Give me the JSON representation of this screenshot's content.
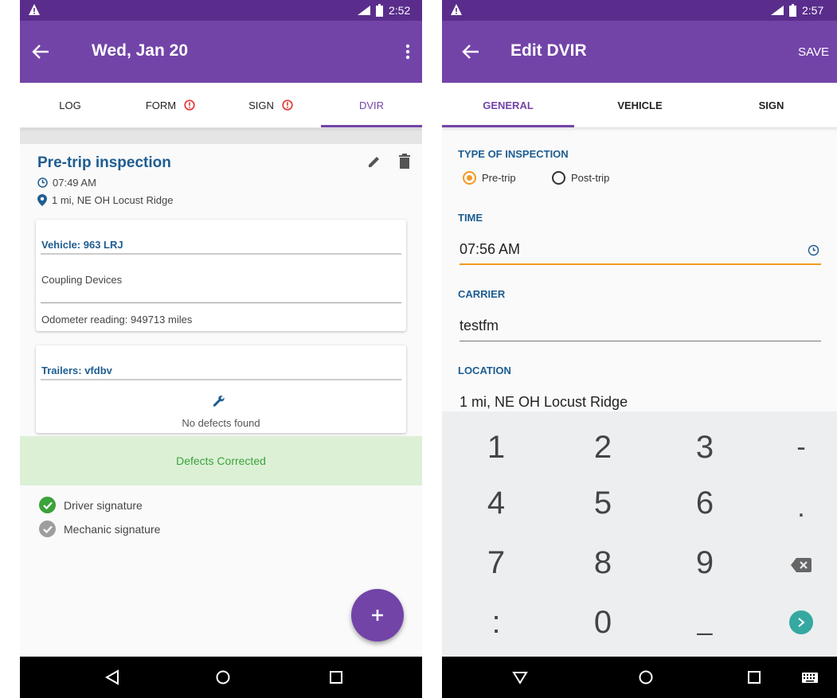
{
  "colors": {
    "primary": "#7244a8",
    "status": "#5a2d8c",
    "accent": "#f39a24",
    "heading_blue": "#1e5d91",
    "alert_red": "#e53935",
    "success_green": "#3ba33a",
    "fab_teal": "#35a8a0"
  },
  "left": {
    "status": {
      "time": "2:52"
    },
    "appbar": {
      "title": "Wed, Jan 20",
      "back_icon": "arrow-back-icon",
      "menu_icon": "more-vert-icon"
    },
    "tabs": [
      {
        "label": "LOG",
        "alert": false,
        "active": false
      },
      {
        "label": "FORM",
        "alert": true,
        "active": false
      },
      {
        "label": "SIGN",
        "alert": true,
        "active": false
      },
      {
        "label": "DVIR",
        "alert": false,
        "active": true
      }
    ],
    "inspection": {
      "title": "Pre-trip inspection",
      "time": "07:49 AM",
      "location": "1 mi, NE OH Locust Ridge"
    },
    "vehicle_card": {
      "header": "Vehicle: 963 LRJ",
      "section": "Coupling Devices",
      "odometer": "Odometer reading: 949713 miles"
    },
    "trailer_card": {
      "header": "Trailers: vfdbv",
      "status": "No defects found"
    },
    "defects_banner": "Defects Corrected",
    "signatures": [
      {
        "label": "Driver signature",
        "signed": true
      },
      {
        "label": "Mechanic signature",
        "signed": false
      }
    ],
    "fab": {
      "icon": "plus-icon"
    },
    "nav": [
      "back-triangle-icon",
      "home-circle-icon",
      "recents-square-icon"
    ]
  },
  "right": {
    "status": {
      "time": "2:57"
    },
    "appbar": {
      "title": "Edit DVIR",
      "action": "SAVE"
    },
    "tabs": [
      {
        "label": "GENERAL",
        "active": true
      },
      {
        "label": "VEHICLE",
        "active": false
      },
      {
        "label": "SIGN",
        "active": false
      }
    ],
    "form": {
      "type_label": "TYPE OF INSPECTION",
      "options": [
        {
          "label": "Pre-trip",
          "selected": true
        },
        {
          "label": "Post-trip",
          "selected": false
        }
      ],
      "time_label": "TIME",
      "time_value": "07:56 AM",
      "carrier_label": "CARRIER",
      "carrier_value": "testfm",
      "location_label": "LOCATION",
      "location_value": "1 mi, NE OH Locust Ridge"
    },
    "keypad": [
      [
        "1",
        "2",
        "3",
        "-"
      ],
      [
        "4",
        "5",
        "6",
        "."
      ],
      [
        "7",
        "8",
        "9",
        "backspace-icon"
      ],
      [
        ":",
        "0",
        "_",
        "next-arrow-icon"
      ]
    ],
    "nav": [
      "back-down-triangle-icon",
      "home-circle-icon",
      "recents-square-icon",
      "keyboard-icon"
    ]
  }
}
